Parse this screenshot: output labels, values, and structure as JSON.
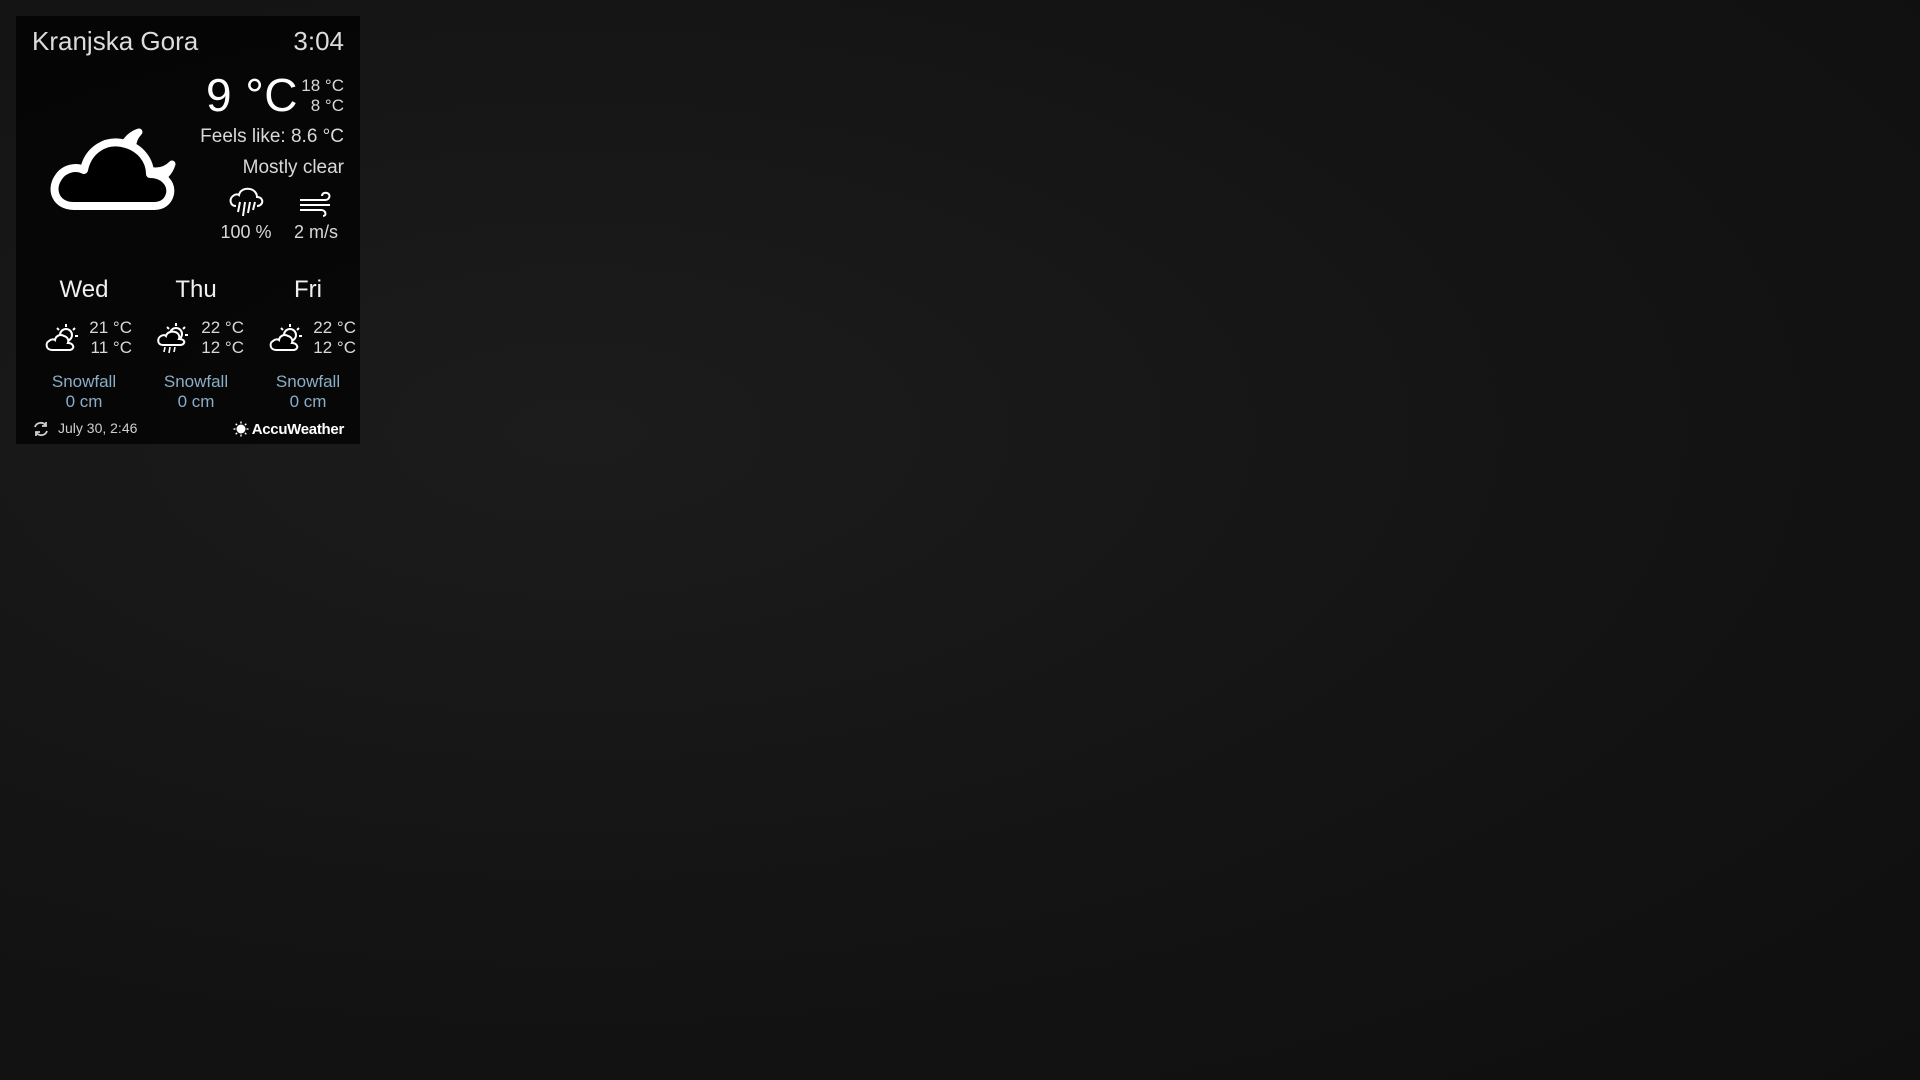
{
  "widget": {
    "location": "Kranjska Gora",
    "time": "3:04",
    "current": {
      "temperature": "9 °C",
      "high": "18 °C",
      "low": "8 °C",
      "feels_like": "Feels like: 8.6 °C",
      "condition": "Mostly clear",
      "condition_icon": "cloud-moon-icon",
      "precipitation": "100 %",
      "precipitation_icon": "rain-cloud-icon",
      "wind": "2 m/s",
      "wind_icon": "wind-icon"
    },
    "forecast": [
      {
        "day": "Wed",
        "high": "21 °C",
        "low": "11 °C",
        "icon": "partly-cloudy-icon",
        "snow_label": "Snowfall",
        "snow_value": "0 cm"
      },
      {
        "day": "Thu",
        "high": "22 °C",
        "low": "12 °C",
        "icon": "sun-cloud-rain-icon",
        "snow_label": "Snowfall",
        "snow_value": "0 cm"
      },
      {
        "day": "Fri",
        "high": "22 °C",
        "low": "12 °C",
        "icon": "partly-cloudy-icon",
        "snow_label": "Snowfall",
        "snow_value": "0 cm"
      }
    ],
    "footer": {
      "updated": "July 30, 2:46",
      "provider": "AccuWeather"
    }
  },
  "colors": {
    "snow_text": "#8aaec7",
    "panel_background": "#000000",
    "page_background": "#141414"
  }
}
